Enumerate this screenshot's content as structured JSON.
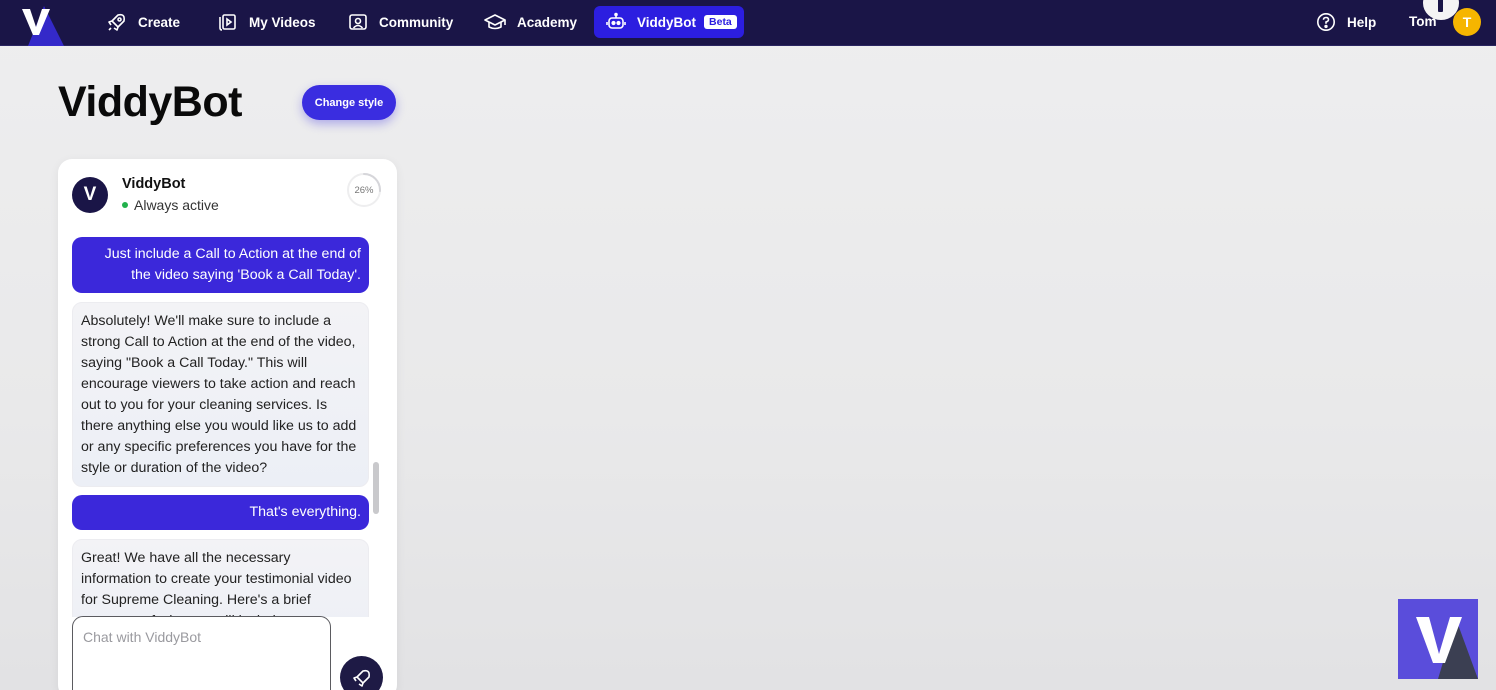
{
  "nav": {
    "logo_letter": "V",
    "items": [
      {
        "label": "Create",
        "icon": "rocket-icon"
      },
      {
        "label": "My Videos",
        "icon": "video-library-icon"
      },
      {
        "label": "Community",
        "icon": "community-icon"
      },
      {
        "label": "Academy",
        "icon": "graduation-cap-icon"
      },
      {
        "label": "ViddyBot",
        "icon": "robot-icon",
        "badge": "Beta",
        "active": true
      }
    ],
    "help_label": "Help",
    "user_name": "Tom",
    "avatar_initial": "T"
  },
  "page": {
    "title": "ViddyBot",
    "change_style_label": "Change style"
  },
  "chat": {
    "bot_initial": "V",
    "bot_name": "ViddyBot",
    "status": "Always active",
    "progress_label": "26%",
    "progress_value": 0.26,
    "messages": [
      {
        "role": "user",
        "text": "Just include a Call to Action at the end of the video saying 'Book a Call Today'."
      },
      {
        "role": "bot",
        "text": "Absolutely! We'll make sure to include a strong Call to Action at the end of the video, saying \"Book a Call Today.\" This will encourage viewers to take action and reach out to you for your cleaning services. Is there anything else you would like us to add or any specific preferences you have for the style or duration of the video?"
      },
      {
        "role": "user",
        "text": "That's everything."
      },
      {
        "role": "bot",
        "text": "Great! We have all the necessary information to create your testimonial video for Supreme Cleaning. Here's a brief summary of what we will include:"
      }
    ],
    "input_placeholder": "Chat with ViddyBot",
    "send_icon": "send-icon"
  },
  "colors": {
    "nav_bg": "#1a1547",
    "accent": "#3a2de0",
    "avatar": "#f6b500",
    "status_online": "#22b14c"
  }
}
